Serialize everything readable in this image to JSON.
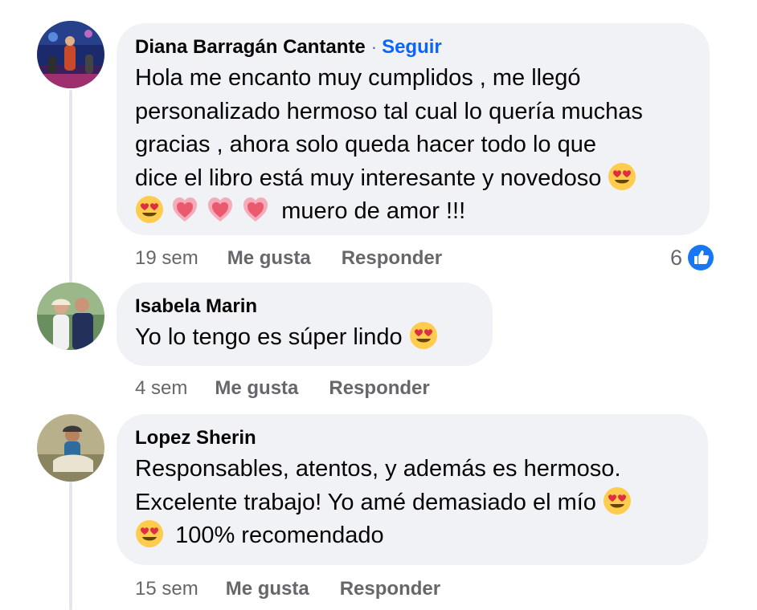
{
  "comments": [
    {
      "author": "Diana Barragán Cantante",
      "follow_separator": "·",
      "follow_label": "Seguir",
      "lines": [
        "Hola me encanto muy cumplidos , me llegó",
        "personalizado hermoso tal cual lo quería muchas",
        "gracias , ahora solo queda hacer todo lo que",
        "dice el libro está muy interesante y novedoso",
        "muero de amor !!!"
      ],
      "time": "19 sem",
      "like_label": "Me gusta",
      "reply_label": "Responder",
      "reaction_count": "6",
      "reaction_icon": "like-icon"
    },
    {
      "author": "Isabela Marin",
      "lines": [
        "Yo lo tengo es súper lindo"
      ],
      "time": "4 sem",
      "like_label": "Me gusta",
      "reply_label": "Responder"
    },
    {
      "author": "Lopez Sherin",
      "lines": [
        "Responsables, atentos, y además es hermoso.",
        "Excelente trabajo! Yo amé demasiado el mío",
        "100% recomendado"
      ],
      "time": "15 sem",
      "like_label": "Me gusta",
      "reply_label": "Responder"
    }
  ],
  "colors": {
    "bubble": "#f0f2f5",
    "meta_text": "#65676b",
    "follow_link": "#0866ff",
    "like_badge": "#1877f2"
  }
}
